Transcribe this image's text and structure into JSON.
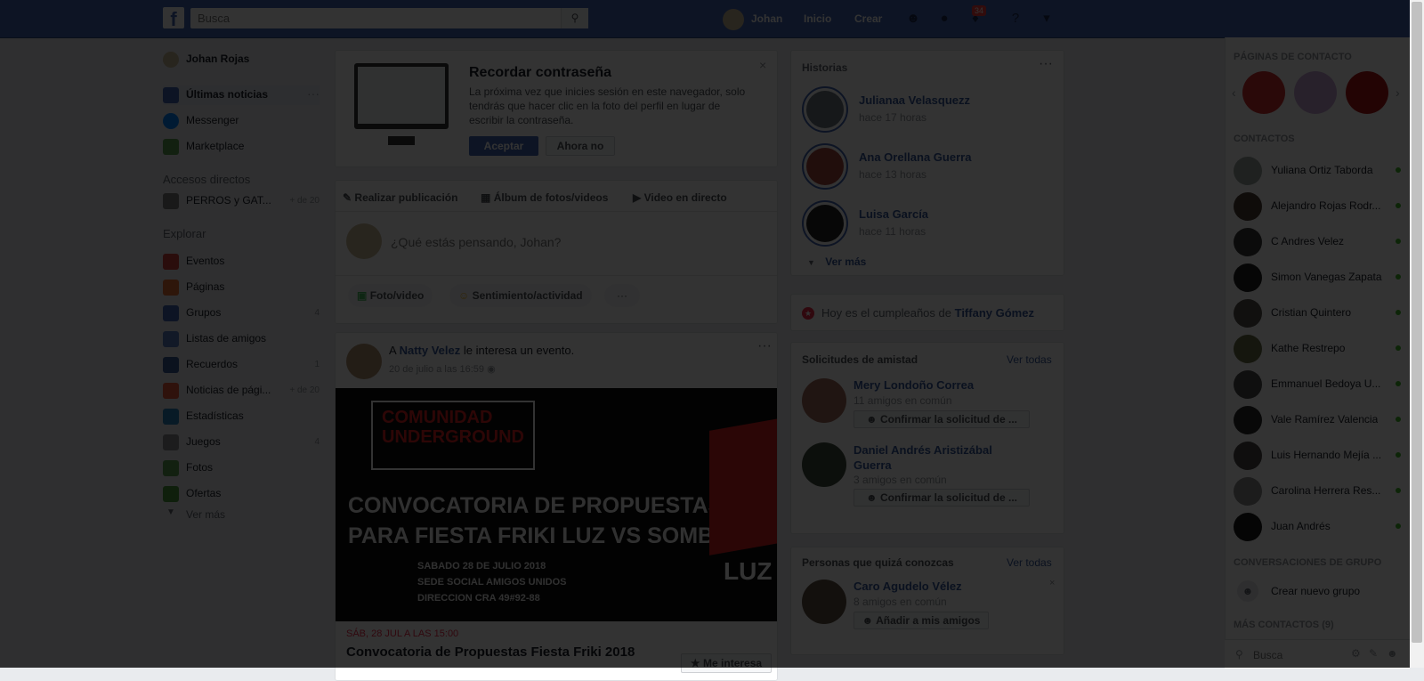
{
  "topbar": {
    "logo": "f",
    "search_placeholder": "Busca",
    "user_name": "Johan",
    "inicio": "Inicio",
    "crear": "Crear",
    "notifications_count": "34"
  },
  "left_nav": {
    "profile_name": "Johan Rojas",
    "main_items": [
      {
        "label": "Últimas noticias",
        "icon": "news-feed-icon"
      },
      {
        "label": "Messenger",
        "icon": "messenger-icon"
      },
      {
        "label": "Marketplace",
        "icon": "marketplace-icon"
      }
    ],
    "shortcuts_title": "Accesos directos",
    "shortcuts": [
      {
        "label": "PERROS y GAT...",
        "count": "+ de 20"
      }
    ],
    "explore_title": "Explorar",
    "explore_items": [
      {
        "label": "Eventos",
        "count": ""
      },
      {
        "label": "Páginas",
        "count": ""
      },
      {
        "label": "Grupos",
        "count": "4"
      },
      {
        "label": "Listas de amigos",
        "count": ""
      },
      {
        "label": "Recuerdos",
        "count": "1"
      },
      {
        "label": "Noticias de pági...",
        "count": "+ de 20"
      },
      {
        "label": "Estadísticas",
        "count": ""
      },
      {
        "label": "Juegos",
        "count": "4"
      },
      {
        "label": "Fotos",
        "count": ""
      },
      {
        "label": "Ofertas",
        "count": ""
      }
    ],
    "see_more": "Ver más"
  },
  "password_card": {
    "title": "Recordar contraseña",
    "body": "La próxima vez que inicies sesión en este navegador, solo tendrás que hacer clic en la foto del perfil en lugar de escribir la contraseña.",
    "accept": "Aceptar",
    "not_now": "Ahora no"
  },
  "composer": {
    "tabs": [
      "Realizar publicación",
      "Álbum de fotos/videos",
      "Video en directo"
    ],
    "placeholder": "¿Qué estás pensando, Johan?",
    "actions": [
      "Foto/video",
      "Sentimiento/actividad"
    ]
  },
  "post": {
    "prefix": "A",
    "author": "Natty Velez",
    "text": "le interesa un evento.",
    "date": "20 de julio a las 16:59",
    "event_date": "SÁB, 28 JUL A LAS 15:00",
    "event_title": "Convocatoria de Propuestas Fiesta Friki 2018",
    "interest_button": "Me interesa",
    "image": {
      "logo_line1": "COMUNIDAD",
      "logo_line2": "UNDERGROUND",
      "headline1": "CONVOCATORIA DE PROPUESTAS",
      "headline2": "PARA FIESTA FRIKI LUZ VS SOMBRA",
      "detail1": "SABADO 28 DE JULIO 2018",
      "detail2": "SEDE SOCIAL AMIGOS UNIDOS",
      "detail3": "DIRECCION CRA 49#92-88",
      "side_text": "LUZ"
    }
  },
  "stories": {
    "title": "Historias",
    "items": [
      {
        "name": "Julianaa Velasquezz",
        "time": "hace 17 horas"
      },
      {
        "name": "Ana Orellana Guerra",
        "time": "hace 13 horas"
      },
      {
        "name": "Luisa García",
        "time": "hace 11 horas"
      }
    ],
    "see_more": "Ver más"
  },
  "birthday": {
    "prefix": "Hoy es el cumpleaños de",
    "name": "Tiffany Gómez"
  },
  "friend_requests": {
    "title": "Solicitudes de amistad",
    "see_all": "Ver todas",
    "items": [
      {
        "name": "Mery Londoño Correa",
        "mutual": "11 amigos en común",
        "action": "Confirmar la solicitud de ..."
      },
      {
        "name": "Daniel Andrés Aristizábal Guerra",
        "mutual": "3 amigos en común",
        "action": "Confirmar la solicitud de ..."
      }
    ]
  },
  "pymk": {
    "title": "Personas que quizá conozcas",
    "see_all": "Ver todas",
    "items": [
      {
        "name": "Caro Agudelo Vélez",
        "mutual": "8 amigos en común",
        "action": "Añadir a mis amigos"
      }
    ]
  },
  "right_sidebar": {
    "pages_title": "PÁGINAS DE CONTACTO",
    "contacts_title": "CONTACTOS",
    "contacts": [
      "Yuliana Ortiz Taborda",
      "Alejandro Rojas Rodr...",
      "C Andres Velez",
      "Simon Vanegas Zapata",
      "Cristian Quintero",
      "Kathe Restrepo",
      "Emmanuel Bedoya U...",
      "Vale Ramírez Valencia",
      "Luis Hernando Mejía ...",
      "Carolina Herrera Res...",
      "Juan Andrés"
    ],
    "group_title": "CONVERSACIONES DE GRUPO",
    "create_group": "Crear nuevo grupo",
    "more_contacts": "MÁS CONTACTOS (9)",
    "search_placeholder": "Busca"
  }
}
